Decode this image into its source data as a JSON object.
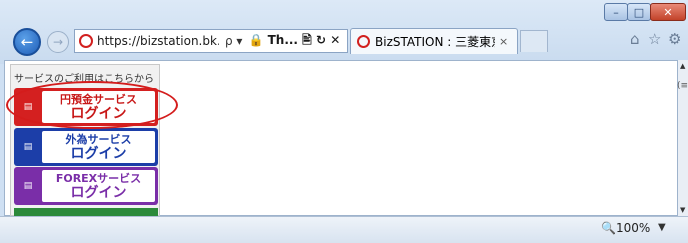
{
  "browser": {
    "url": "https://bizstation.bk.mu...",
    "address_controls": "ρ ▾",
    "second_tab_text": "🔒 Th... 🖹 ↻ ✕",
    "tab_title": "BizSTATION : 三菱東京...",
    "tab_close": "×",
    "zoom": "🔍100%",
    "zoom_arrow": "▼"
  },
  "page": {
    "panel_title": "サービスのご利用はこちらから",
    "services": [
      {
        "line1": "円預金サービス",
        "line2": "ログイン",
        "color": "#d42020"
      },
      {
        "line1": "外為サービス",
        "line2": "ログイン",
        "color": "#1c3ea8"
      },
      {
        "line1": "FOREXサービス",
        "line2": "ログイン",
        "color": "#7a2ea8"
      }
    ],
    "side_glyph": "(≡)"
  },
  "icons": {
    "back": "←",
    "forward": "→",
    "home": "⌂",
    "star": "☆",
    "gear": "⚙",
    "service_icon": "▤",
    "minimize": "–",
    "maximize": "□",
    "close": "✕",
    "scroll_up": "▲",
    "scroll_down": "▼"
  }
}
